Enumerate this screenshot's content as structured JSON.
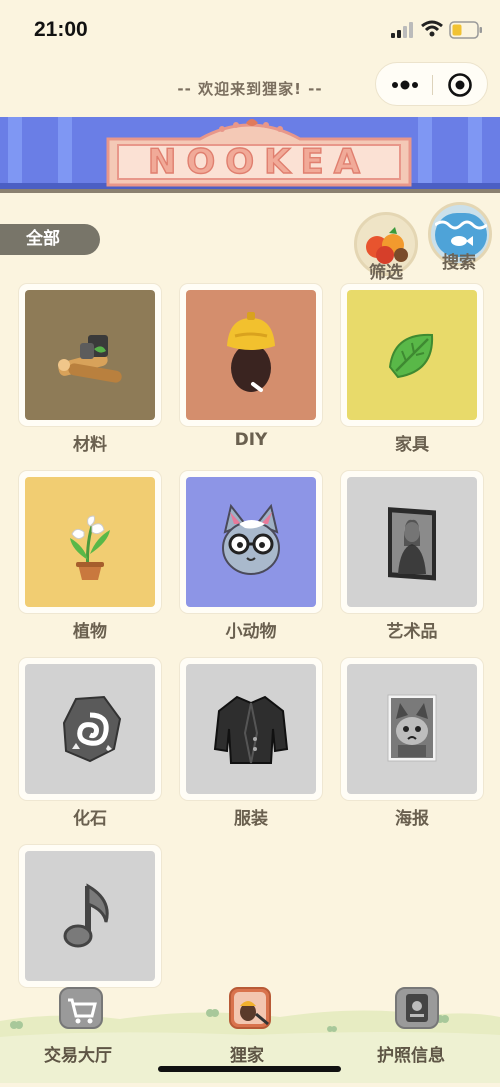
{
  "status_bar": {
    "time": "21:00"
  },
  "header": {
    "title": "-- 欢迎来到狸家! --"
  },
  "banner": {
    "logo_text": "NOOKEA"
  },
  "filter_tabs": {
    "all_label": "全部"
  },
  "actions": {
    "filter_label": "筛选",
    "search_label": "搜索"
  },
  "categories": [
    {
      "label": "材料",
      "color": "#8e7b57",
      "icon": "lumber-icon"
    },
    {
      "label": "DIY",
      "color": "#d48e6d",
      "icon": "acorn-icon"
    },
    {
      "label": "家具",
      "color": "#e8da6a",
      "icon": "leaf-icon"
    },
    {
      "label": "植物",
      "color": "#f1cd72",
      "icon": "lily-flower-icon"
    },
    {
      "label": "小动物",
      "color": "#8d95e6",
      "icon": "cat-villager-icon"
    },
    {
      "label": "艺术品",
      "color": "#d2d2d2",
      "icon": "painting-icon"
    },
    {
      "label": "化石",
      "color": "#d2d2d2",
      "icon": "fossil-icon"
    },
    {
      "label": "服装",
      "color": "#d2d2d2",
      "icon": "jacket-icon"
    },
    {
      "label": "海报",
      "color": "#d2d2d2",
      "icon": "poster-icon"
    },
    {
      "label": "",
      "color": "#d2d2d2",
      "icon": "music-note-icon"
    }
  ],
  "bottom_nav": {
    "items": [
      {
        "label": "交易大厅",
        "icon": "shopping-cart-icon"
      },
      {
        "label": "狸家",
        "icon": "nook-leaf-icon"
      },
      {
        "label": "护照信息",
        "icon": "passport-icon"
      }
    ]
  }
}
